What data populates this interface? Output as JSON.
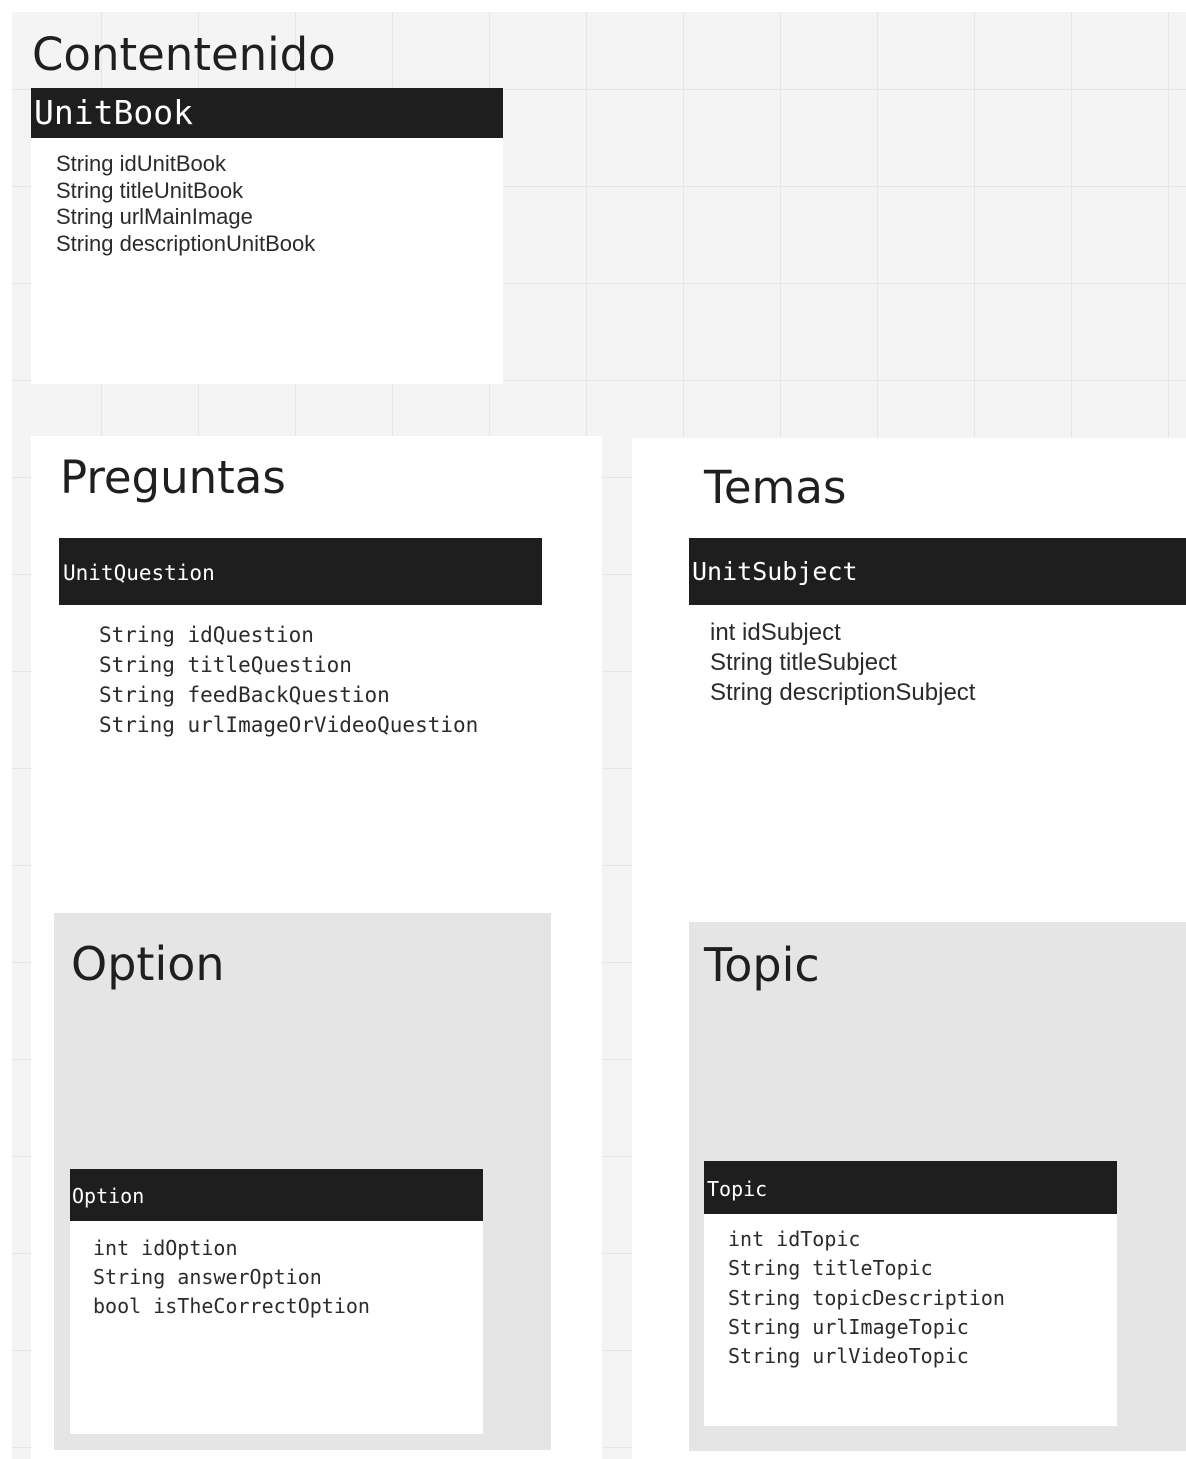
{
  "contenido": {
    "title": "Contentenido",
    "class_name": "UnitBook",
    "fields": [
      "String idUnitBook",
      "String titleUnitBook",
      "String urlMainImage",
      "String descriptionUnitBook"
    ]
  },
  "preguntas": {
    "title": "Preguntas",
    "class_name": "UnitQuestion",
    "fields": [
      "String idQuestion",
      "String titleQuestion",
      "String feedBackQuestion",
      "String urlImageOrVideoQuestion"
    ]
  },
  "temas": {
    "title": "Temas",
    "class_name": "UnitSubject",
    "fields": [
      "int idSubject",
      "String titleSubject",
      "String descriptionSubject"
    ]
  },
  "option_frame": {
    "title": "Option",
    "class_name": "Option",
    "fields": [
      "int idOption",
      "String answerOption",
      "bool isTheCorrectOption"
    ]
  },
  "topic_frame": {
    "title": "Topic",
    "class_name": "Topic",
    "fields": [
      "int idTopic",
      "String titleTopic",
      "String topicDescription",
      "String urlImageTopic",
      "String urlVideoTopic"
    ]
  }
}
